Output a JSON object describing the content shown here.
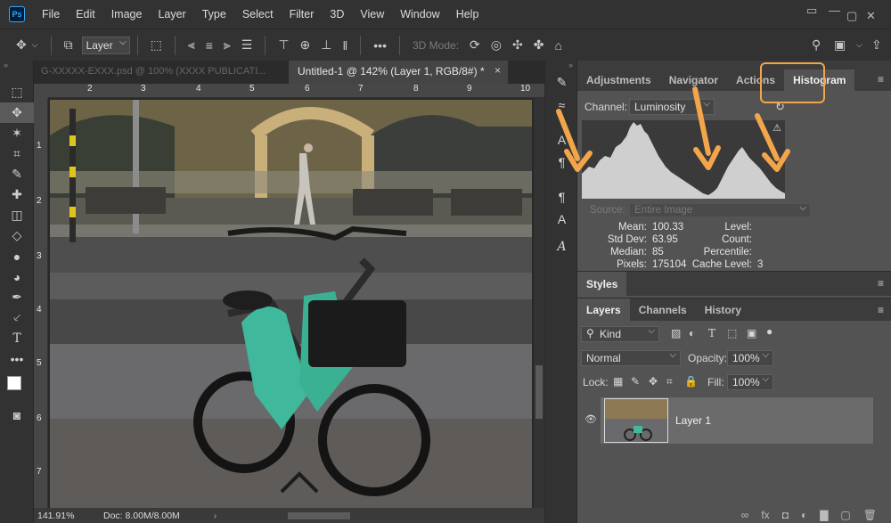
{
  "menubar": {
    "logo": "Ps",
    "items": [
      "File",
      "Edit",
      "Image",
      "Layer",
      "Type",
      "Select",
      "Filter",
      "3D",
      "View",
      "Window",
      "Help"
    ],
    "window_controls": [
      "▭",
      "—",
      "▢",
      "✕"
    ]
  },
  "options_bar": {
    "layer_select": "Layer",
    "mode_label": "3D Mode:",
    "ellipsis": "•••"
  },
  "document": {
    "inactive_tab": "G-XXXXX-EXXX.psd @ 100% (XXXX PUBLICATI...",
    "active_tab": "Untitled-1 @ 142% (Layer 1, RGB/8#) *",
    "close_glyph": "×",
    "ruler_top": [
      "2",
      "3",
      "4",
      "5",
      "6",
      "7",
      "8",
      "9",
      "10"
    ],
    "ruler_left": [
      "1",
      "2",
      "3",
      "4",
      "5",
      "6",
      "7"
    ],
    "zoom": "141.91%",
    "doc_size": "Doc: 8.00M/8.00M"
  },
  "toolbar_collapse": "»",
  "right_panel": {
    "top_tabs": [
      "Adjustments",
      "Navigator",
      "Actions",
      "Histogram"
    ],
    "active_top_tab": "Histogram",
    "channel_label": "Channel:",
    "channel_value": "Luminosity",
    "warning": "⚠",
    "source_label": "Source:",
    "source_value": "Entire Image",
    "stats_left": [
      {
        "label": "Mean:",
        "value": "100.33"
      },
      {
        "label": "Std Dev:",
        "value": "63.95"
      },
      {
        "label": "Median:",
        "value": "85"
      },
      {
        "label": "Pixels:",
        "value": "175104"
      }
    ],
    "stats_right": [
      {
        "label": "Level:",
        "value": ""
      },
      {
        "label": "Count:",
        "value": ""
      },
      {
        "label": "Percentile:",
        "value": ""
      },
      {
        "label": "Cache Level:",
        "value": "3"
      }
    ],
    "styles_title": "Styles",
    "layer_tabs": [
      "Layers",
      "Channels",
      "History"
    ],
    "kind_filter": "Kind",
    "blend_mode": "Normal",
    "opacity_label": "Opacity:",
    "opacity_value": "100%",
    "lock_label": "Lock:",
    "fill_label": "Fill:",
    "fill_value": "100%",
    "layer_name": "Layer 1",
    "eye": "👁",
    "footer_icons": [
      "∞",
      "fx",
      "◘",
      "◐",
      "▇",
      "▢",
      "🗑"
    ]
  },
  "colors": {
    "accent_highlight": "#f2a54a",
    "ps_blue": "#31a8ff",
    "panel_bg": "#535353",
    "dark_bg": "#323232"
  }
}
